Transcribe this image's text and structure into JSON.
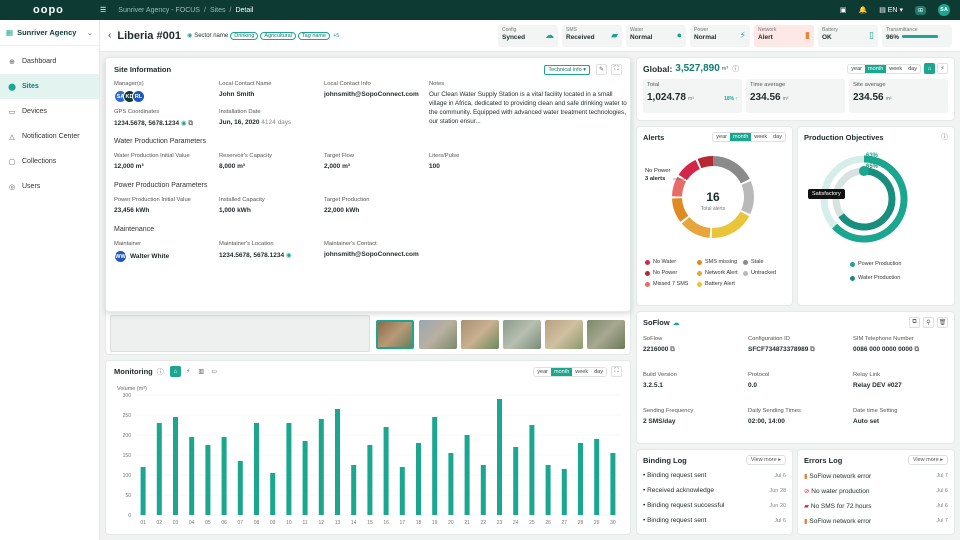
{
  "topbar": {
    "logo": "oopo",
    "breadcrumb": [
      "Sunriver Agency - FOCUS",
      "Sites",
      "Detail"
    ],
    "lang": "EN",
    "user_initials": "SA",
    "badge": "⊞"
  },
  "sidebar": {
    "org": "Sunriver Agency",
    "items": [
      {
        "label": "Dashboard",
        "icon": "grid-icon"
      },
      {
        "label": "Sites",
        "icon": "pin-icon"
      },
      {
        "label": "Devices",
        "icon": "device-icon"
      },
      {
        "label": "Notification Center",
        "icon": "bell-icon"
      },
      {
        "label": "Collections",
        "icon": "folder-icon"
      },
      {
        "label": "Users",
        "icon": "user-icon"
      }
    ]
  },
  "header": {
    "title": "Liberia #001",
    "sector": "Sector name",
    "tags": [
      "Drinking",
      "Agricultural",
      "Tag name"
    ],
    "more_tags": "+5",
    "status": [
      {
        "label": "Config",
        "value": "Synced"
      },
      {
        "label": "SMS",
        "value": "Received"
      },
      {
        "label": "Water",
        "value": "Normal"
      },
      {
        "label": "Power",
        "value": "Normal"
      },
      {
        "label": "Network",
        "value": "Alert"
      },
      {
        "label": "Battery",
        "value": "OK"
      },
      {
        "label": "Transmittance",
        "value": "96%",
        "progress": 0.96
      }
    ]
  },
  "site_info": {
    "title": "Site Information",
    "tech_info": "Technical info",
    "labels": {
      "managers": "Manager(s)",
      "local_contact": "Local Contact Name",
      "local_info": "Local Contact Info",
      "notes": "Notes",
      "gps": "GPS Coordinates",
      "install_date": "Installation Date"
    },
    "manager_avatars": [
      "SA",
      "KD",
      "RL"
    ],
    "local_contact": "John Smith",
    "local_info": "johnsmith@SopoConnect.com",
    "notes": "Our Clean Water Supply Station is a vital facility located in a small village in Africa, dedicated to providing clean and safe drinking water to the community. Equipped with advanced water treatment technologies, our station ensur...",
    "gps": "1234.5678, 5678.1234",
    "install_date": "Jun, 16, 2020",
    "install_ago": "4124 days",
    "water_title": "Water Production Parameters",
    "water_labels": [
      "Water Production Initial Value",
      "Reservoir's Capacity",
      "Target Flow",
      "Liters/Pulse"
    ],
    "water_values": [
      "12,000 m³",
      "8,000 m³",
      "2,000 m³",
      "100"
    ],
    "power_title": "Power Production Parameters",
    "power_labels": [
      "Power Production Initial Value",
      "Installed Capacity",
      "Target Production"
    ],
    "power_values": [
      "23,456 kWh",
      "1,000 kWh",
      "22,000 kWh"
    ],
    "maint_title": "Maintenance",
    "maint_labels": [
      "Maintainer",
      "Maintainer's Location",
      "Maintainer's Contact"
    ],
    "maintainer_initials": "WW",
    "maintainer": "Walter White",
    "maint_location": "1234.5678, 5678.1234",
    "maint_contact": "johnsmith@SopoConnect.com"
  },
  "global": {
    "label": "Global:",
    "value": "3,527,890",
    "unit": "m³",
    "ranges": [
      "year",
      "month",
      "week",
      "day"
    ],
    "total_label": "Total",
    "total": "1,024.78",
    "total_change": "18% ↑",
    "time_label": "Time average",
    "time": "234.56",
    "site_label": "Site average",
    "site": "234.56",
    "unit_small": "m³"
  },
  "alerts": {
    "title": "Alerts",
    "ranges": [
      "year",
      "month",
      "week",
      "day"
    ],
    "total": "16",
    "total_label": "Total alerts",
    "callout": "No Power",
    "callout_count": "3 alerts",
    "legend": [
      {
        "label": "No Water",
        "color": "#d3264a"
      },
      {
        "label": "SMS missing",
        "color": "#e08a22"
      },
      {
        "label": "Stale",
        "color": "#8a8a8a"
      },
      {
        "label": "No Power",
        "color": "#b8292f"
      },
      {
        "label": "Network Alert",
        "color": "#e8a53a"
      },
      {
        "label": "Untracked",
        "color": "#b9b9b9"
      },
      {
        "label": "Missed 7 SMS",
        "color": "#ea6a66"
      },
      {
        "label": "Battery Alert",
        "color": "#e8c53a"
      }
    ]
  },
  "production": {
    "title": "Production Objectives",
    "tooltip": "Satisfactory",
    "outer_pct": "63%",
    "inner_pct": "65%",
    "outer_value": 0.63,
    "inner_value": 0.65,
    "legend": [
      "Power Production",
      "Water Production"
    ]
  },
  "soflow": {
    "title": "SoFlow",
    "labels": [
      "SoFlow",
      "Configuration ID",
      "SIM Telephone Number",
      "Build Version",
      "Protocol",
      "Relay Link",
      "Sending Frequency",
      "Daily Sending Times",
      "Date time Setting"
    ],
    "values": [
      "2216000",
      "SFCF734873378989",
      "0086 000 0000 0000",
      "3.2.5.1",
      "0.0",
      "Relay DEV #027",
      "2 SMS/day",
      "02:00, 14:00",
      "Auto set"
    ]
  },
  "binding": {
    "title": "Binding Log",
    "view_more": "View more",
    "items": [
      {
        "text": "Binding request sent",
        "date": "Jul 6"
      },
      {
        "text": "Received acknowledge",
        "date": "Jun 28"
      },
      {
        "text": "Binding request successful",
        "date": "Jun 20"
      },
      {
        "text": "Binding request sent",
        "date": "Jul 6"
      }
    ]
  },
  "errors": {
    "title": "Errors Log",
    "view_more": "View more",
    "items": [
      {
        "text": "SoFlow network error",
        "date": "Jul 7",
        "color": "#e8833a"
      },
      {
        "text": "No water production",
        "date": "Jul 6",
        "color": "#d3264a"
      },
      {
        "text": "No SMS for 72 hours",
        "date": "Jul 6",
        "color": "#d3264a"
      },
      {
        "text": "SoFlow network error",
        "date": "Jul 7",
        "color": "#e8833a"
      }
    ]
  },
  "monitoring": {
    "title": "Monitoring",
    "ranges": [
      "year",
      "month",
      "week",
      "day"
    ]
  },
  "chart_data": {
    "type": "bar",
    "title": "",
    "ylabel": "Volume (m³)",
    "ylim": [
      0,
      300
    ],
    "yticks": [
      0,
      50,
      100,
      150,
      200,
      250,
      300
    ],
    "categories": [
      "01",
      "02",
      "03",
      "04",
      "05",
      "06",
      "07",
      "08",
      "09",
      "10",
      "11",
      "12",
      "13",
      "14",
      "15",
      "16",
      "17",
      "18",
      "19",
      "20",
      "21",
      "22",
      "23",
      "24",
      "25",
      "26",
      "27",
      "28",
      "29",
      "30"
    ],
    "values": [
      120,
      230,
      245,
      195,
      175,
      195,
      135,
      230,
      105,
      230,
      185,
      240,
      265,
      125,
      175,
      220,
      120,
      180,
      245,
      155,
      200,
      125,
      290,
      170,
      225,
      125,
      115,
      180,
      190,
      155
    ],
    "color": "#1aa68f"
  }
}
